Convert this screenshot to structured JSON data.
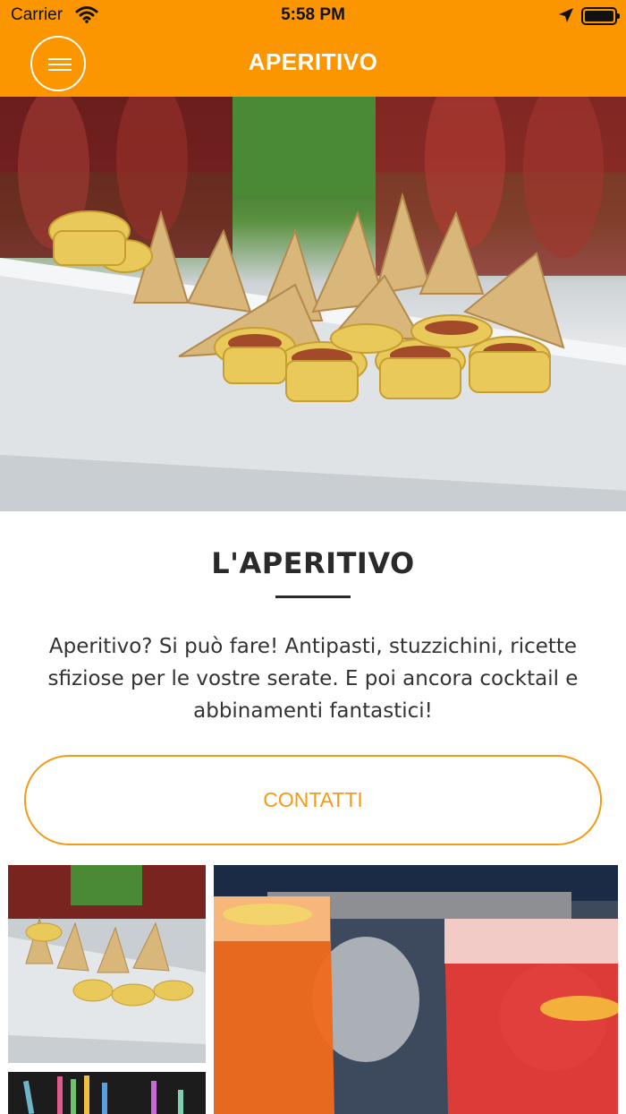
{
  "status_bar": {
    "carrier": "Carrier",
    "time": "5:58 PM"
  },
  "nav": {
    "title": "APERITIVO"
  },
  "content": {
    "heading": "L'APERITIVO",
    "description": "Aperitivo? Si può fare! Antipasti, stuzzichini, ricette sfiziose per le vostre serate. E poi ancora cocktail e abbinamenti fantastici!",
    "contact_button": "CONTATTI"
  },
  "colors": {
    "accent": "#fb9600",
    "button_border": "#f39a16",
    "heading_text": "#2a2a2a"
  },
  "icons": [
    "menu-icon",
    "wifi-icon",
    "location-arrow-icon",
    "battery-icon"
  ]
}
